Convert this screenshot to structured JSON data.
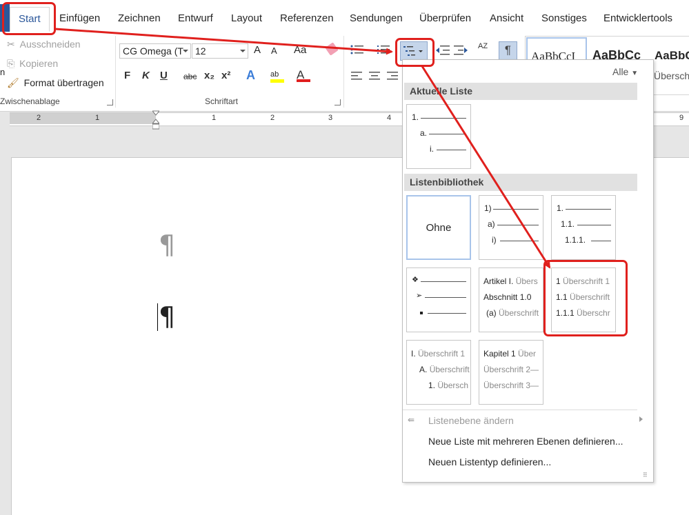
{
  "ribbon": {
    "tabs": [
      "Start",
      "Einfügen",
      "Zeichnen",
      "Entwurf",
      "Layout",
      "Referenzen",
      "Sendungen",
      "Überprüfen",
      "Ansicht",
      "Sonstiges",
      "Entwicklertools"
    ],
    "clipboard": {
      "cut": "Ausschneiden",
      "copy": "Kopieren",
      "format_painter": "Format übertragen",
      "group_label": "Zwischenablage",
      "stub": "n"
    },
    "font": {
      "name": "CG Omega (T",
      "size": "12",
      "grow": "A",
      "shrink": "A",
      "case": "Aa",
      "group_label": "Schriftart",
      "bold": "F",
      "italic": "K",
      "underline": "U",
      "strike": "abc",
      "sub": "x₂",
      "sup": "x²",
      "text_effects": "A",
      "highlight": "ab",
      "font_color": "A"
    },
    "paragraph": {
      "sort": "AZ",
      "pilcrow": "¶"
    },
    "styles": [
      {
        "preview": "AaBbCcI"
      },
      {
        "preview": "AaBbCc"
      },
      {
        "preview": "AaBbC",
        "name": "Übersch"
      }
    ]
  },
  "ruler": {
    "numbers": [
      "2",
      "1",
      "1",
      "2",
      "3",
      "4",
      "9"
    ]
  },
  "document": {
    "pilcrow": "¶"
  },
  "menu": {
    "filter": "Alle",
    "current_list_heading": "Aktuelle Liste",
    "current_list": {
      "l1": "1.",
      "l2": "a.",
      "l3": "i."
    },
    "library_heading": "Listenbibliothek",
    "library": {
      "none": "Ohne",
      "paren": {
        "l1": "1)",
        "l2": "a)",
        "l3": "i)"
      },
      "decimal": {
        "l1": "1.",
        "l2": "1.1.",
        "l3": "1.1.1."
      },
      "heading_decimal": {
        "n1": "1",
        "t1": "Überschrift 1",
        "n2": "1.1",
        "t2": "Überschrift",
        "n3": "1.1.1",
        "t3": "Überschr"
      },
      "article": {
        "n1": "Artikel I.",
        "t1": "Übers",
        "n2": "Abschnitt 1.0",
        "n3": "(a)",
        "t3": "Überschrift"
      },
      "roman": {
        "n1": "I.",
        "t1": "Überschrift 1",
        "n2": "A.",
        "t2": "Überschrift",
        "n3": "1.",
        "t3": "Übersch"
      },
      "chapter": {
        "n1": "Kapitel 1",
        "t1": "Über",
        "t2": "Überschrift 2—",
        "t3": "Überschrift 3—"
      }
    },
    "change_level": "Listenebene ändern",
    "define_multilevel": "Neue Liste mit mehreren Ebenen definieren...",
    "define_style": "Neuen Listentyp definieren..."
  },
  "colors": {
    "annotation": "#e0201d",
    "accent": "#2b579a",
    "highlight": "#ffff00",
    "font_color": "#e01e1e"
  }
}
